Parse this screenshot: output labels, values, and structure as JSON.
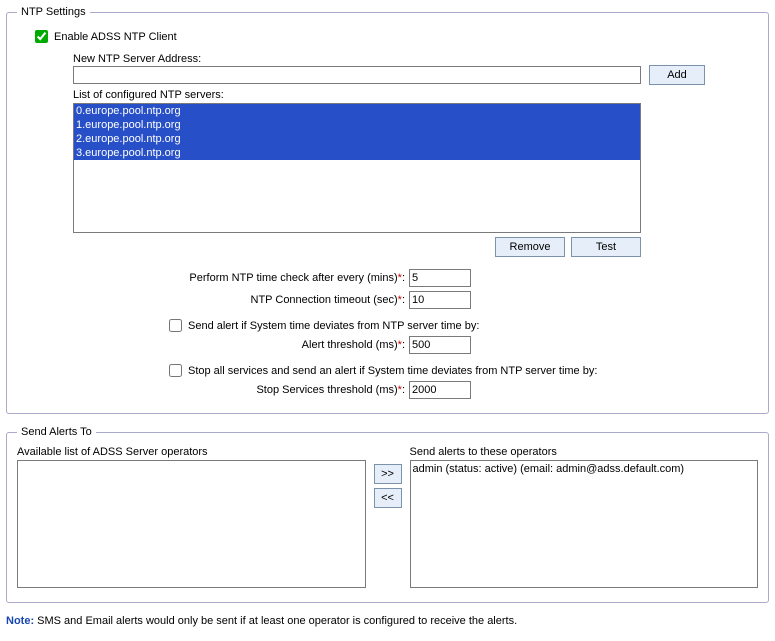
{
  "ntp": {
    "legend": "NTP Settings",
    "enable_label": "Enable ADSS NTP Client",
    "new_server_label": "New NTP Server Address:",
    "new_server_value": "",
    "add_btn": "Add",
    "list_label": "List of configured NTP servers:",
    "servers": [
      "0.europe.pool.ntp.org",
      "1.europe.pool.ntp.org",
      "2.europe.pool.ntp.org",
      "3.europe.pool.ntp.org"
    ],
    "remove_btn": "Remove",
    "test_btn": "Test",
    "check_every_label": "Perform NTP time check after every (mins)",
    "check_every_value": "5",
    "timeout_label": "NTP Connection timeout (sec)",
    "timeout_value": "10",
    "deviate_label": "Send alert if System time deviates from NTP server time by:",
    "alert_threshold_label": "Alert threshold (ms)",
    "alert_threshold_value": "500",
    "stopall_label": "Stop all services and send an alert if System time deviates from NTP server time by:",
    "stop_threshold_label": "Stop Services threshold (ms)",
    "stop_threshold_value": "2000"
  },
  "alerts": {
    "legend": "Send Alerts To",
    "available_label": "Available list of ADSS Server operators",
    "selected_label": "Send alerts to these operators",
    "move_right": ">>",
    "move_left": "<<",
    "available": [],
    "selected": [
      "admin (status: active) (email: admin@adss.default.com)"
    ]
  },
  "note_prefix": "Note:",
  "note_text": " SMS and Email alerts would only be sent if at least one operator is configured to receive the alerts."
}
